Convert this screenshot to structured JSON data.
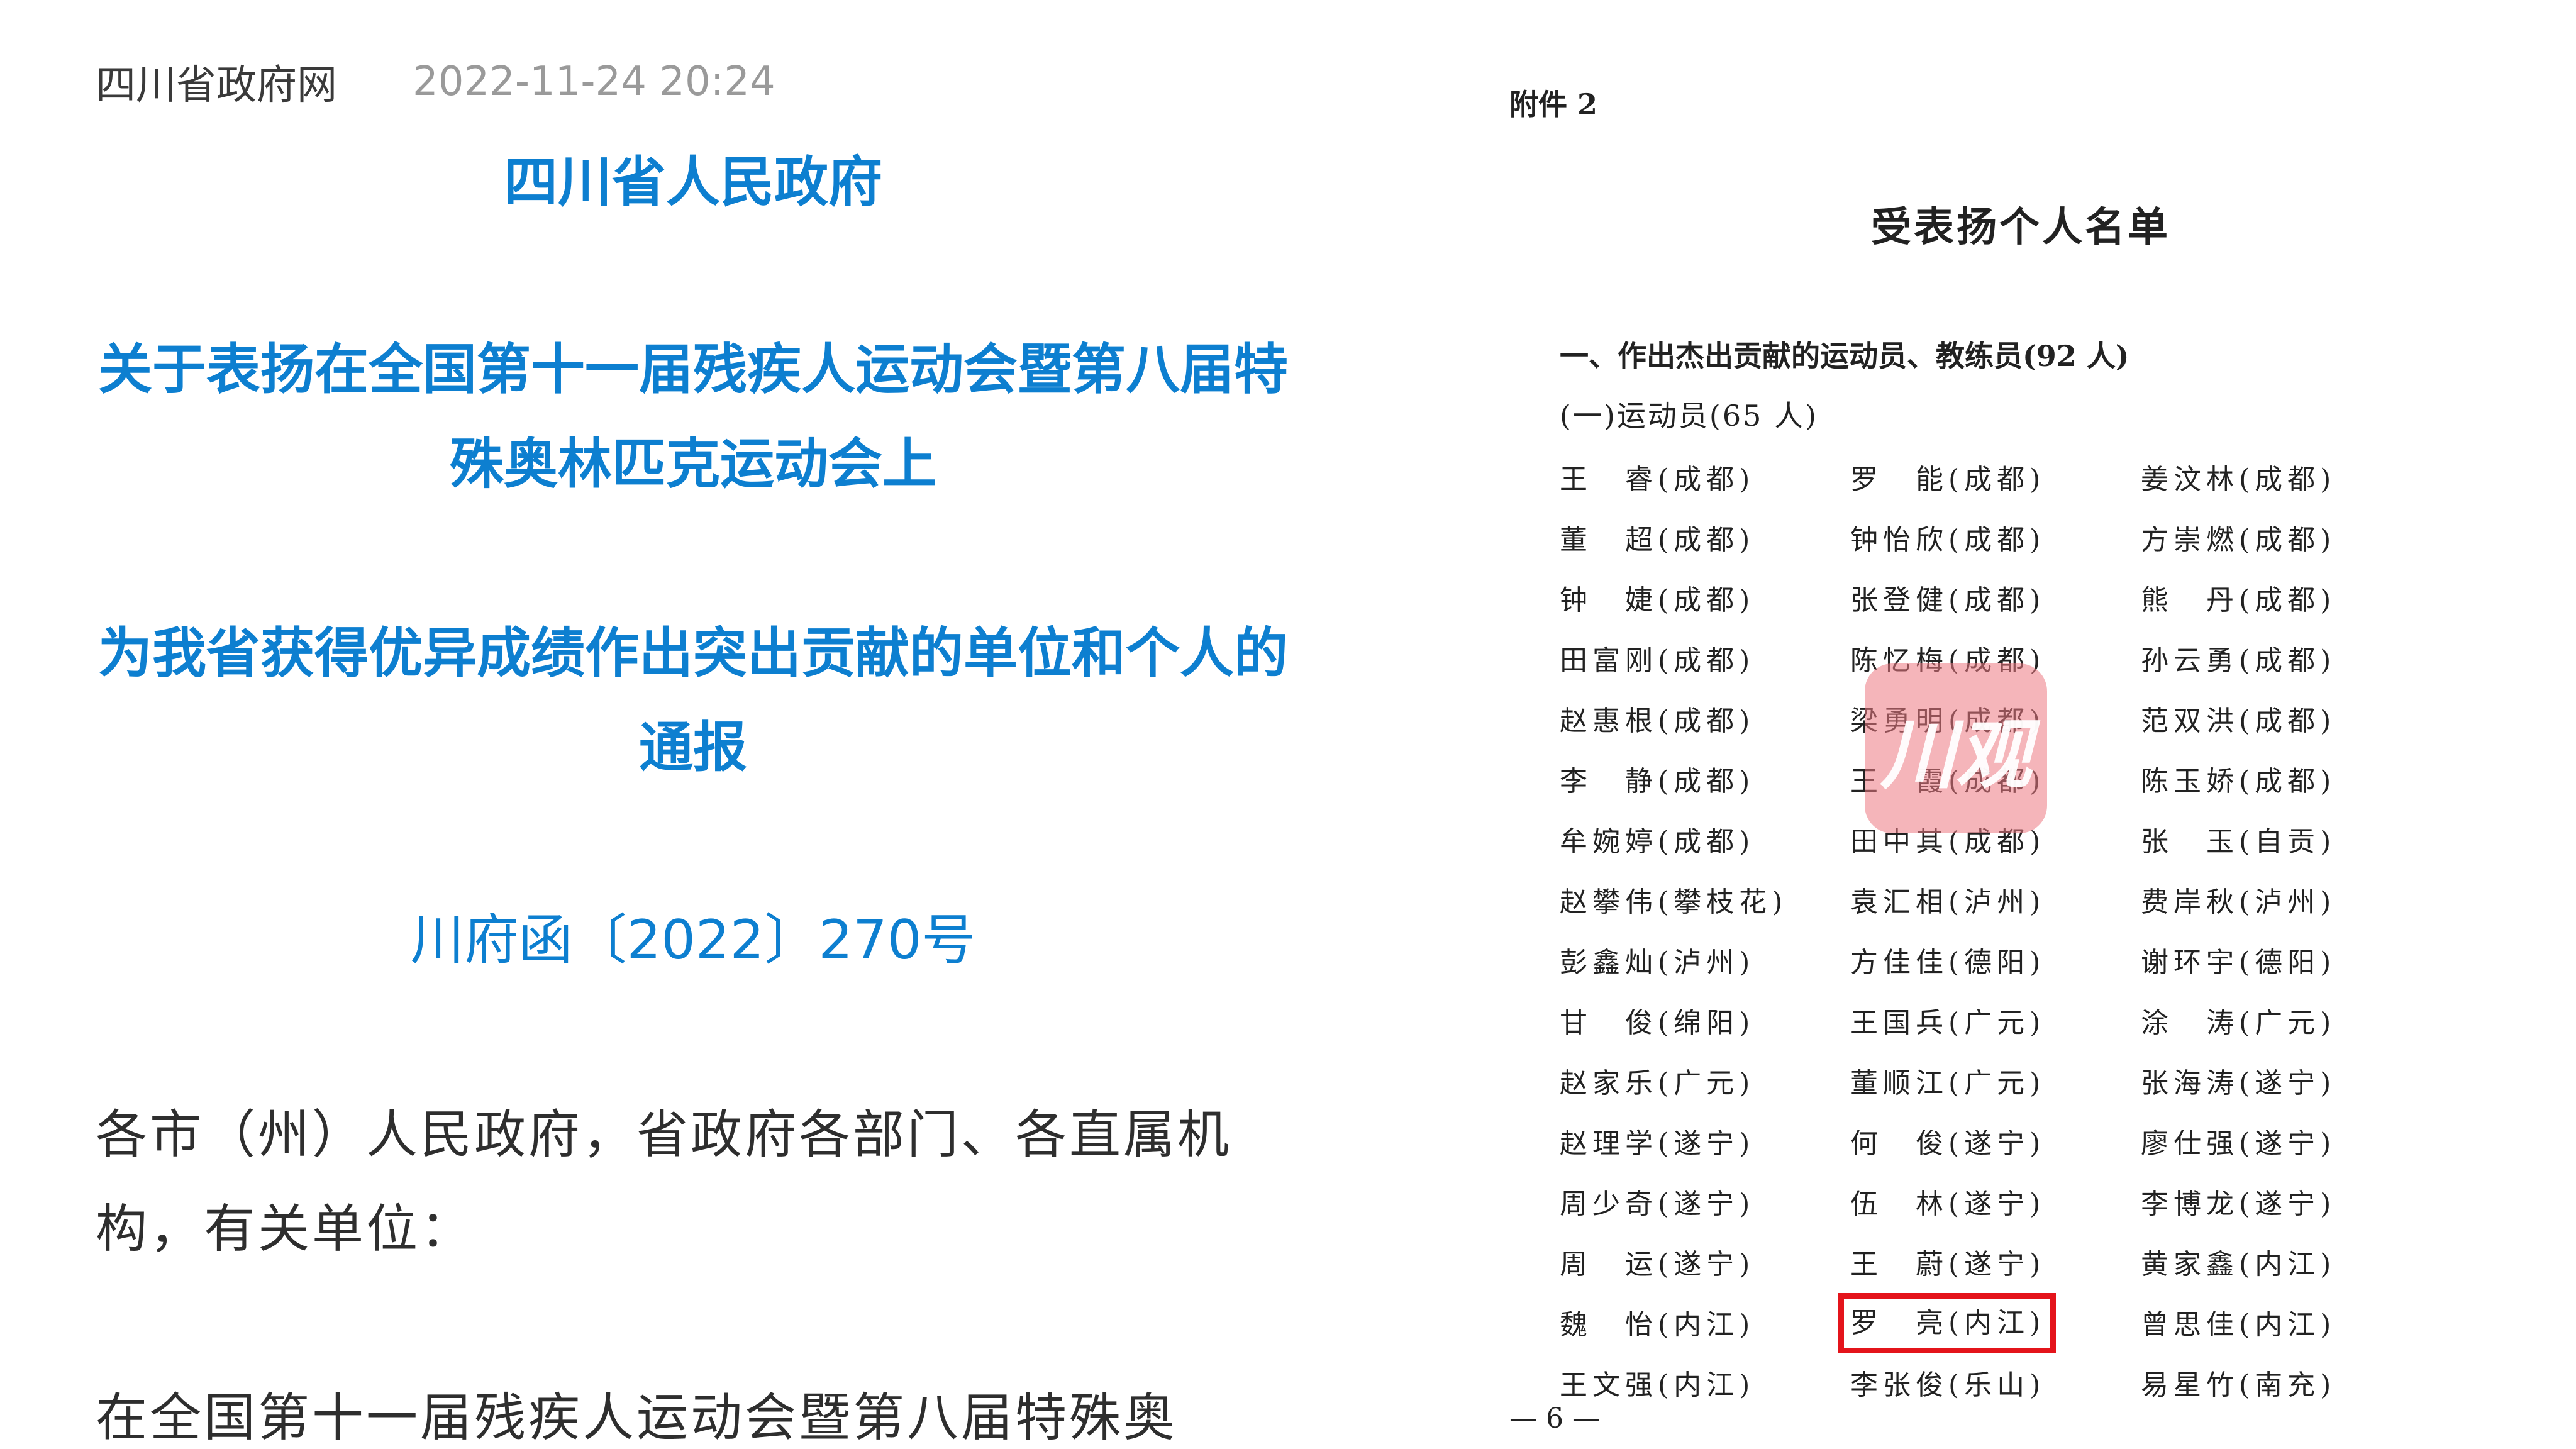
{
  "article": {
    "source": "四川省政府网",
    "datetime": "2022-11-24 20:24",
    "title_org": "四川省人民政府",
    "title_line1": "关于表扬在全国第十一届残疾人运动会暨第八届特殊奥林匹克运动会上",
    "title_line2": "为我省获得优异成绩作出突出贡献的单位和个人的通报",
    "doc_number": "川府函〔2022〕270号",
    "salutation": "各市（州）人民政府，省政府各部门、各直属机构，有关单位：",
    "paragraph_start": "在全国第十一届残疾人运动会暨第八届特殊奥"
  },
  "document": {
    "attachment_label": "附件 2",
    "list_title": "受表扬个人名单",
    "section_1": "一、作出杰出贡献的运动员、教练员(92 人)",
    "subsection_1": "(一)运动员(65 人)",
    "names": [
      [
        "王　睿(成都)",
        "罗　能(成都)",
        "姜汶林(成都)"
      ],
      [
        "董　超(成都)",
        "钟怡欣(成都)",
        "方崇燃(成都)"
      ],
      [
        "钟　婕(成都)",
        "张登健(成都)",
        "熊　丹(成都)"
      ],
      [
        "田富刚(成都)",
        "陈忆梅(成都)",
        "孙云勇(成都)"
      ],
      [
        "赵惠根(成都)",
        "梁勇明(成都)",
        "范双洪(成都)"
      ],
      [
        "李　静(成都)",
        "王　霞(成都)",
        "陈玉娇(成都)"
      ],
      [
        "牟婉婷(成都)",
        "田中其(成都)",
        "张　玉(自贡)"
      ],
      [
        "赵攀伟(攀枝花)",
        "袁汇相(泸州)",
        "费岸秋(泸州)"
      ],
      [
        "彭鑫灿(泸州)",
        "方佳佳(德阳)",
        "谢环宇(德阳)"
      ],
      [
        "甘　俊(绵阳)",
        "王国兵(广元)",
        "涂　涛(广元)"
      ],
      [
        "赵家乐(广元)",
        "董顺江(广元)",
        "张海涛(遂宁)"
      ],
      [
        "赵理学(遂宁)",
        "何　俊(遂宁)",
        "廖仕强(遂宁)"
      ],
      [
        "周少奇(遂宁)",
        "伍　林(遂宁)",
        "李博龙(遂宁)"
      ],
      [
        "周　运(遂宁)",
        "王　蔚(遂宁)",
        "黄家鑫(内江)"
      ],
      [
        "魏　怡(内江)",
        "罗　亮(内江)",
        "曾思佳(内江)"
      ],
      [
        "王文强(内江)",
        "李张俊(乐山)",
        "易星竹(南充)"
      ]
    ],
    "highlighted_name": "罗　亮(内江)",
    "highlight_color": "#e4141b",
    "page_number": "— 6 —",
    "watermark_text": "川观"
  },
  "colors": {
    "title_blue": "#0d7fd0",
    "body_text": "#2e2e2e",
    "meta_gray": "#9a9a9a"
  }
}
